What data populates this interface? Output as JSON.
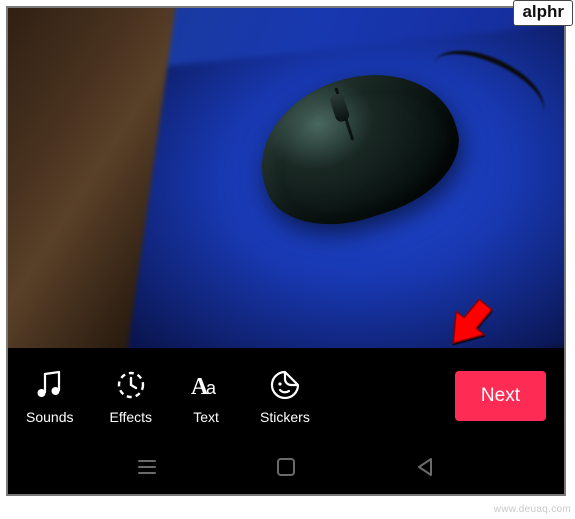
{
  "badge": "alphr",
  "toolbar": {
    "sounds": "Sounds",
    "effects": "Effects",
    "text": "Text",
    "stickers": "Stickers",
    "next": "Next"
  },
  "watermark": "www.deuaq.com"
}
